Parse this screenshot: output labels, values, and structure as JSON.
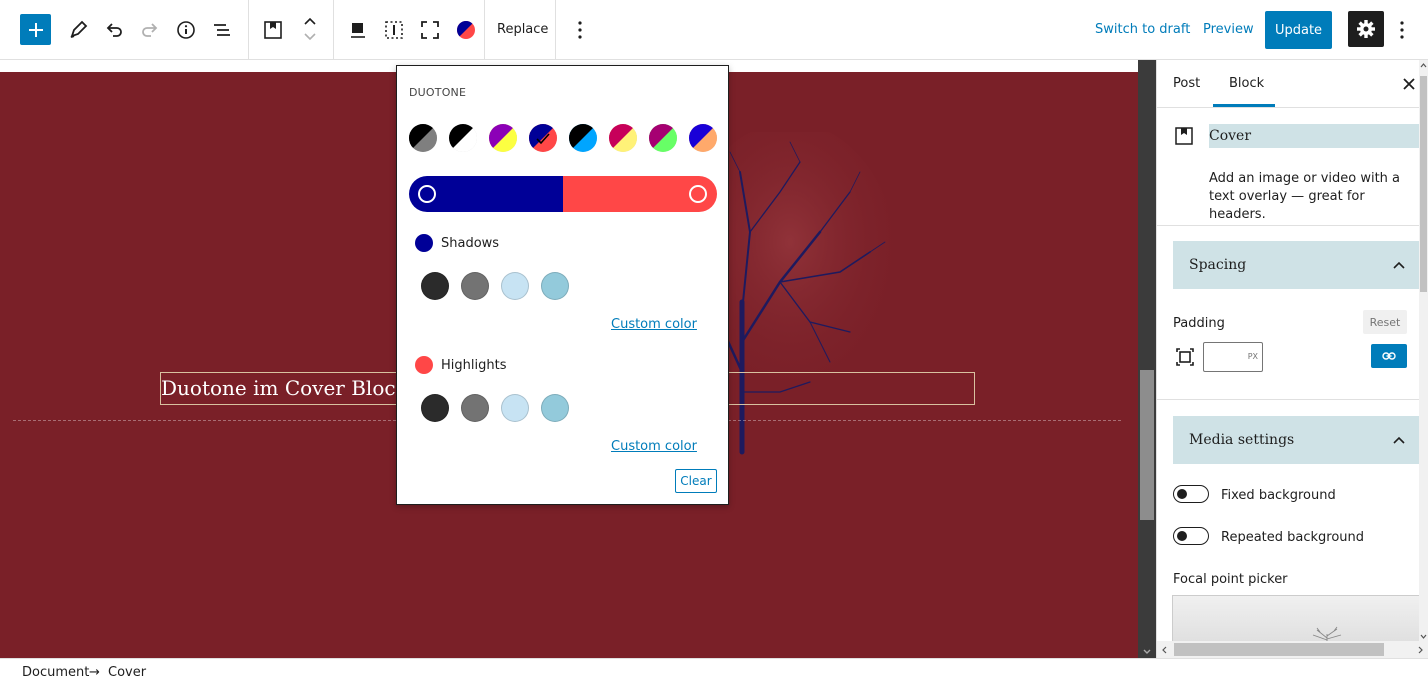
{
  "toolbar": {
    "replace_label": "Replace",
    "switch_to_draft_label": "Switch to draft",
    "preview_label": "Preview",
    "update_label": "Update"
  },
  "canvas": {
    "heading_text": "Duotone im Cover Block",
    "background_color": "#7a2028"
  },
  "duotone": {
    "title": "DUOTONE",
    "presets": [
      {
        "name": "dark-grayscale",
        "colors": [
          "#000000",
          "#7f7f7f"
        ]
      },
      {
        "name": "grayscale",
        "colors": [
          "#000000",
          "#ffffff"
        ]
      },
      {
        "name": "purple-yellow",
        "colors": [
          "#8c00b7",
          "#fcff41"
        ]
      },
      {
        "name": "blue-red",
        "colors": [
          "#000097",
          "#ff4747"
        ],
        "selected": true
      },
      {
        "name": "midnight",
        "colors": [
          "#000000",
          "#00a5ff"
        ]
      },
      {
        "name": "magenta-yellow",
        "colors": [
          "#c7005a",
          "#fff278"
        ]
      },
      {
        "name": "purple-green",
        "colors": [
          "#a60072",
          "#67ff66"
        ]
      },
      {
        "name": "blue-orange",
        "colors": [
          "#1900d8",
          "#ffa96b"
        ]
      }
    ],
    "shadow_color": "#000097",
    "highlight_color": "#ff4747",
    "shadows_label": "Shadows",
    "highlights_label": "Highlights",
    "palette": [
      "#2b2b2b",
      "#737373",
      "#c7e3f3",
      "#93cadb"
    ],
    "custom_color_label": "Custom color",
    "clear_label": "Clear"
  },
  "sidebar": {
    "tabs": [
      {
        "label": "Post"
      },
      {
        "label": "Block",
        "active": true
      }
    ],
    "block_name": "Cover",
    "block_description": "Add an image or video with a text overlay — great for headers.",
    "spacing": {
      "title": "Spacing",
      "padding_label": "Padding",
      "reset_label": "Reset",
      "unit": "PX"
    },
    "media": {
      "title": "Media settings",
      "fixed_background_label": "Fixed background",
      "repeated_background_label": "Repeated background",
      "focal_point_label": "Focal point picker"
    }
  },
  "breadcrumb": {
    "document_label": "Document",
    "arrow": "→",
    "current_label": "Cover"
  },
  "colors": {
    "accent": "#007cba",
    "panel_highlight": "#cfe2e6"
  }
}
